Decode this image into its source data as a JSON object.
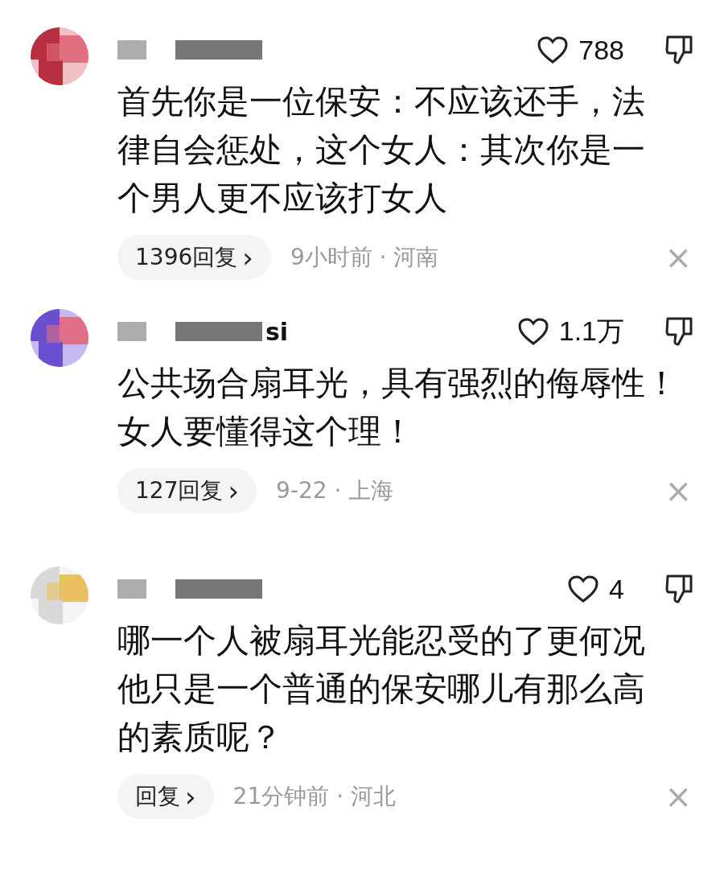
{
  "comments": [
    {
      "likes": "788",
      "lines": [
        "首先你是一位保安：不应该还手，法",
        "律自会惩处，这个女人：其次你是一",
        "个男人更不应该打女人"
      ],
      "replies": "1396回复",
      "chevron": "›",
      "meta": "9小时前 · 河南",
      "close": "×"
    },
    {
      "name_suffix": "si",
      "likes": "1.1万",
      "lines": [
        "公共场合扇耳光，具有强烈的侮辱性！",
        "女人要懂得这个理！"
      ],
      "replies": "127回复",
      "chevron": "›",
      "meta": "9-22 · 上海",
      "close": "×"
    },
    {
      "likes": "4",
      "lines": [
        "哪一个人被扇耳光能忍受的了更何况",
        "他只是一个普通的保安哪儿有那么高",
        "的素质呢？"
      ],
      "replies": "回复",
      "chevron": "›",
      "meta": "21分钟前 · 河北",
      "close": "×"
    }
  ]
}
